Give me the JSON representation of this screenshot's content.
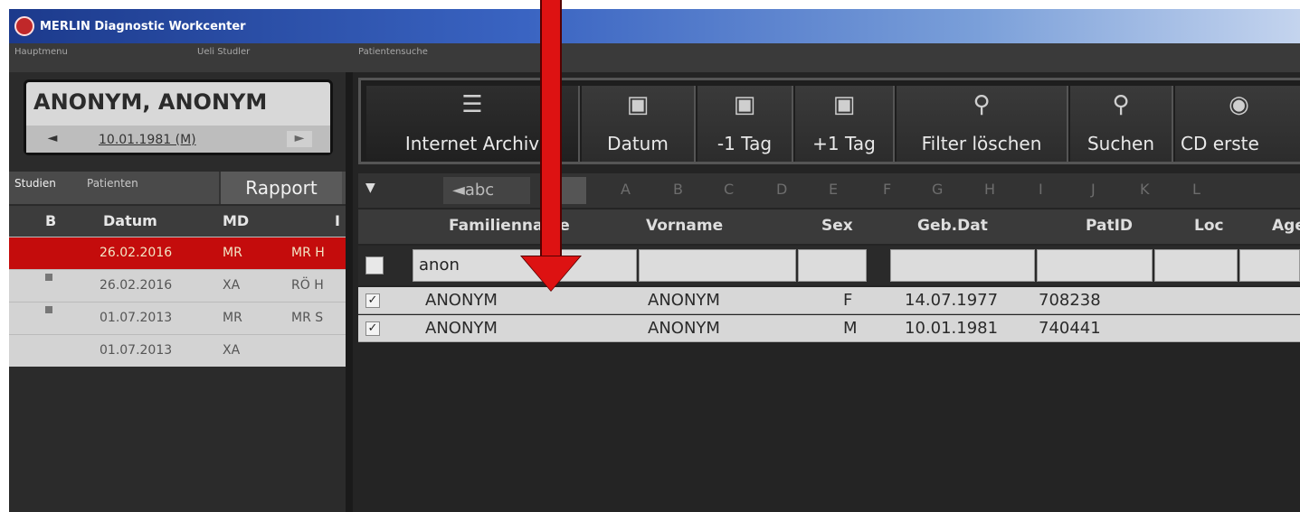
{
  "window": {
    "title": "MERLIN Diagnostic Workcenter",
    "menu_left": "Hauptmenu",
    "menu_user": "Ueli Studler",
    "menu_right": "Patientensuche"
  },
  "patient": {
    "name": "ANONYM, ANONYM",
    "dob": "10.01.1981 (M)",
    "prev_icon": "◄",
    "next_icon": "►"
  },
  "left_tabs": {
    "studien": "Studien",
    "patienten": "Patienten",
    "rapport": "Rapport"
  },
  "studies": {
    "headers": [
      "B",
      "Datum",
      "MD",
      "I"
    ],
    "rows": [
      {
        "datum": "26.02.2016",
        "md": "MR",
        "desc": "MR H"
      },
      {
        "datum": "26.02.2016",
        "md": "XA",
        "desc": "RÖ H"
      },
      {
        "datum": "01.07.2013",
        "md": "MR",
        "desc": "MR S"
      },
      {
        "datum": "01.07.2013",
        "md": "XA",
        "desc": ""
      }
    ]
  },
  "toolbar": {
    "buttons": [
      {
        "label": "Internet Archiv",
        "icon": "server-icon"
      },
      {
        "label": "Datum",
        "icon": "calendar-icon"
      },
      {
        "label": "-1 Tag",
        "icon": "calendar-minus-icon"
      },
      {
        "label": "+1 Tag",
        "icon": "calendar-plus-icon"
      },
      {
        "label": "Filter löschen",
        "icon": "filter-clear-icon"
      },
      {
        "label": "Suchen",
        "icon": "search-icon"
      },
      {
        "label": "CD erste",
        "icon": "cd-icon"
      }
    ]
  },
  "alpha": {
    "dropdown": "▼",
    "abc": "◄abc",
    "letters": [
      "A",
      "B",
      "C",
      "D",
      "E",
      "F",
      "G",
      "H",
      "I",
      "J",
      "K",
      "L"
    ]
  },
  "grid": {
    "headers": [
      "Familienname",
      "Vorname",
      "Sex",
      "Geb.Dat",
      "PatID",
      "Loc",
      "Age"
    ],
    "filter": {
      "familienname": "anon"
    },
    "rows": [
      {
        "check": "✓",
        "familienname": "ANONYM",
        "vorname": "ANONYM",
        "sex": "F",
        "gebdat": "14.07.1977",
        "patid": "708238"
      },
      {
        "check": "✓",
        "familienname": "ANONYM",
        "vorname": "ANONYM",
        "sex": "M",
        "gebdat": "10.01.1981",
        "patid": "740441"
      }
    ]
  },
  "colors": {
    "selected_row": "#c40c0c",
    "annotation_arrow": "#dd1212",
    "title_bar": "#1c3a8c"
  }
}
